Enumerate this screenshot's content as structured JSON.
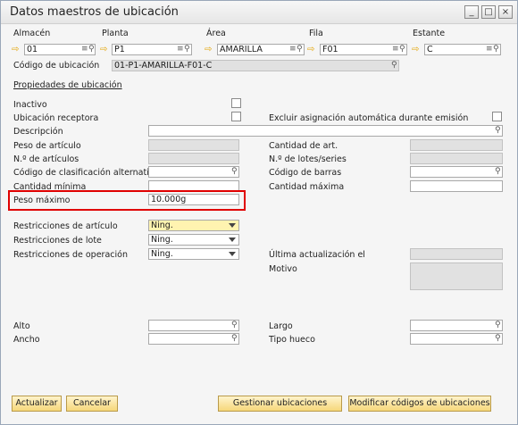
{
  "window": {
    "title": "Datos maestros de ubicación"
  },
  "header": {
    "almacen": {
      "label": "Almacén",
      "value": "01"
    },
    "planta": {
      "label": "Planta",
      "value": "P1"
    },
    "area": {
      "label": "Área",
      "value": "AMARILLA"
    },
    "fila": {
      "label": "Fila",
      "value": "F01"
    },
    "estante": {
      "label": "Estante",
      "value": "C"
    },
    "codigo": {
      "label": "Código de ubicación",
      "value": "01-P1-AMARILLA-F01-C"
    }
  },
  "section": {
    "title": "Propiedades de ubicación"
  },
  "left": {
    "inactivo": "Inactivo",
    "receptora": "Ubicación receptora",
    "descripcion": "Descripción",
    "peso_articulo": "Peso de artículo",
    "num_articulos": "N.º de artículos",
    "codigo_clasif": "Código de clasificación alternativo",
    "cantidad_minima": "Cantidad mínima",
    "peso_maximo": {
      "label": "Peso máximo",
      "value": "10.000g"
    },
    "restr_articulo": {
      "label": "Restricciones de artículo",
      "value": "Ning."
    },
    "restr_lote": {
      "label": "Restricciones de lote",
      "value": "Ning."
    },
    "restr_operacion": {
      "label": "Restricciones de operación",
      "value": "Ning."
    },
    "alto": "Alto",
    "ancho": "Ancho"
  },
  "right": {
    "excluir": "Excluir asignación automática durante emisión",
    "cantidad_art": "Cantidad de art.",
    "num_lotes": "N.º de lotes/series",
    "codigo_barras": "Código de barras",
    "cantidad_maxima": "Cantidad máxima",
    "ultima_actualizacion": "Última actualización el",
    "motivo": "Motivo",
    "largo": "Largo",
    "tipo_hueco": "Tipo hueco"
  },
  "buttons": {
    "actualizar": "Actualizar",
    "cancelar": "Cancelar",
    "gestionar": "Gestionar ubicaciones",
    "modificar": "Modificar códigos de ubicaciones"
  },
  "glyphs": {
    "arrow": "⇨",
    "search": "⚲",
    "list": "≡",
    "minimize": "_",
    "maximize": "□",
    "close": "×"
  }
}
